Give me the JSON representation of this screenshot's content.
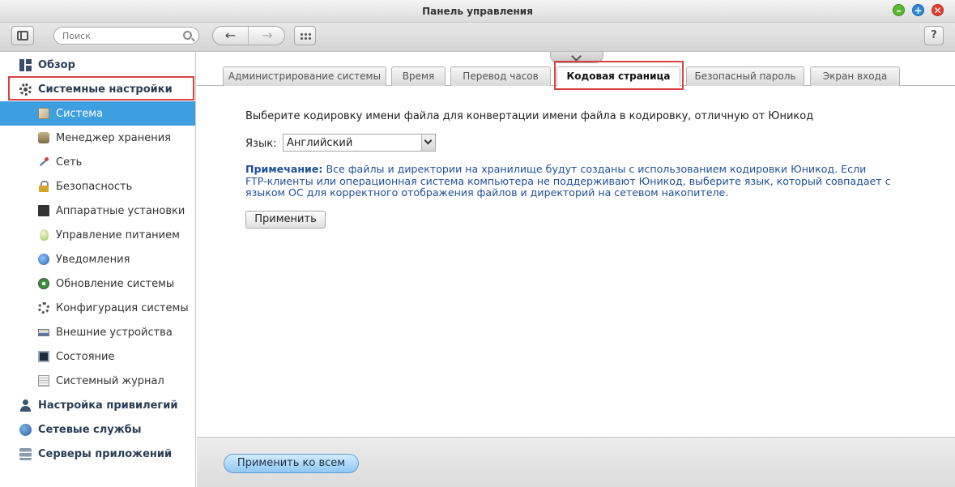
{
  "window": {
    "title": "Панель управления",
    "minimize": "–",
    "maximize": "+",
    "close": "✕"
  },
  "toolbar": {
    "search_placeholder": "Поиск",
    "back": "←",
    "forward": "→",
    "help": "?"
  },
  "sidebar": {
    "overview": "Обзор",
    "system_settings": "Системные настройки",
    "sub_items": [
      "Система",
      "Менеджер хранения",
      "Сеть",
      "Безопасность",
      "Аппаратные установки",
      "Управление питанием",
      "Уведомления",
      "Обновление системы",
      "Конфигурация системы",
      "Внешние устройства",
      "Состояние",
      "Системный журнал"
    ],
    "privileges": "Настройка привилегий",
    "network_services": "Сетевые службы",
    "app_servers": "Серверы приложений"
  },
  "tabs": [
    "Администрирование системы",
    "Время",
    "Перевод часов",
    "Кодовая страница",
    "Безопасный пароль",
    "Экран входа"
  ],
  "codepage": {
    "intro": "Выберите кодировку имени файла для конвертации имени файла в кодировку, отличную от Юникод",
    "language_label": "Язык:",
    "language_value": "Английский",
    "note_title": "Примечание:",
    "note_line1": " Все файлы и директории на хранилище будут созданы с использованием кодировки Юникод. Если",
    "note_line2": "FTP-клиенты или операционная система компьютера не поддерживают Юникод, выберите язык, который совпадает с",
    "note_line3": "языком ОС для корректного отображения файлов и директорий на сетевом накопителе.",
    "apply": "Применить"
  },
  "footer": {
    "apply_all": "Применить ко всем"
  }
}
